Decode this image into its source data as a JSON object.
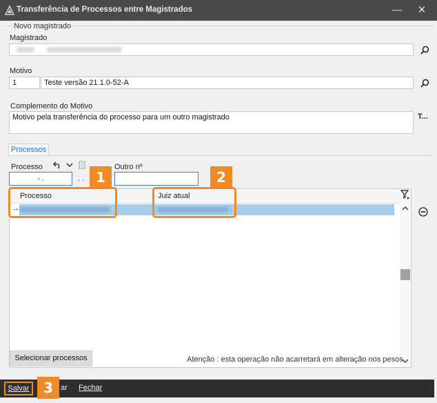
{
  "window": {
    "title": "Transferência de Processos entre Magistrados",
    "minimize_glyph": "—",
    "close_glyph": "✕"
  },
  "new_magistrate": {
    "legend": "Novo magistrado",
    "magistrado_label": "Magistrado",
    "motivo_label": "Motivo",
    "motivo_code": "1",
    "motivo_text": "Teste versão 21.1.0-52-A",
    "complemento_label": "Complemento do Motivo",
    "complemento_text": "Motivo pela transferência do processo para um outro magistrado",
    "complemento_button": "T..."
  },
  "tabs": [
    {
      "label": "Processos"
    }
  ],
  "processos": {
    "processo_label": "Processo",
    "processo_mask": "- .",
    "dots": ". .",
    "outro_label": "Outro nº",
    "columns": [
      "Processo",
      "Juiz atual"
    ],
    "row_pointer": "→",
    "select_button": "Selecionar processos",
    "warning": "Atenção : esta operação não acarretará em alteração nos pesos."
  },
  "callouts": [
    "1",
    "2",
    "3"
  ],
  "footer": {
    "save": "Salvar",
    "cancel_partial": "ar",
    "close": "Fechar"
  },
  "colors": {
    "accent": "#f08a24",
    "titlebar": "#4a4a4a",
    "footer": "#2e2e2e",
    "selection": "#a8cdea",
    "tab_text": "#1a6fc0"
  }
}
